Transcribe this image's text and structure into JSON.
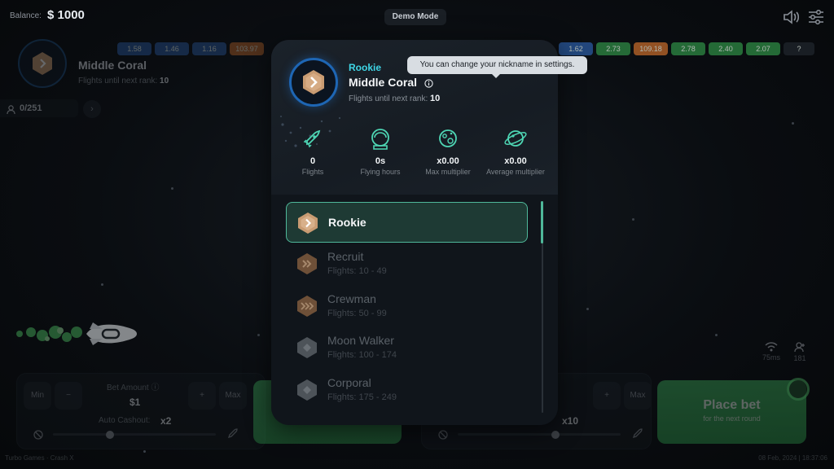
{
  "header": {
    "balance_label": "Balance:",
    "balance_value": "$ 1000",
    "mode": "Demo Mode"
  },
  "history": [
    {
      "value": "1.58",
      "color": "#2a5aa0"
    },
    {
      "value": "1.46",
      "color": "#2a5aa0"
    },
    {
      "value": "1.16",
      "color": "#2a5aa0"
    },
    {
      "value": "103.97",
      "color": "#c0682a"
    },
    {
      "value": "1.62",
      "color": "#2a5aa0"
    },
    {
      "value": "2.73",
      "color": "#2e8a44"
    },
    {
      "value": "109.18",
      "color": "#c0682a"
    },
    {
      "value": "2.78",
      "color": "#2e8a44"
    },
    {
      "value": "2.40",
      "color": "#2e8a44"
    },
    {
      "value": "2.07",
      "color": "#2e8a44"
    },
    {
      "value": "?",
      "color": "#1f252c"
    }
  ],
  "background_profile": {
    "name": "Middle Coral",
    "flights_label": "Flights until next rank:",
    "flights_value": "10",
    "players": "0/251"
  },
  "bet_panel_left": {
    "min": "Min",
    "minus": "−",
    "plus": "+",
    "max": "Max",
    "bet_amount_label": "Bet Amount",
    "bet_amount_value": "$1",
    "auto_cashout_label": "Auto Cashout:",
    "auto_cashout_value": "x2",
    "slider_fraction": 0.35
  },
  "bet_panel_right": {
    "plus": "+",
    "max": "Max",
    "auto_cashout_value": "x10",
    "place_bet_title": "Place bet",
    "place_bet_sub": "for the next round",
    "slider_fraction": 0.6
  },
  "network": {
    "ping": "75ms",
    "users": "181"
  },
  "footer": {
    "left": "Turbo Games · Crash X",
    "right": "08 Feb, 2024 | 18:37:06"
  },
  "modal": {
    "rank_label": "Rookie",
    "nickname": "Middle Coral",
    "tooltip": "You can change your nickname in settings.",
    "next_rank_label": "Flights until next rank:",
    "next_rank_value": "10",
    "stats": [
      {
        "value": "0",
        "label": "Flights",
        "icon": "rocket-icon"
      },
      {
        "value": "0s",
        "label": "Flying hours",
        "icon": "helmet-icon"
      },
      {
        "value": "x0.00",
        "label": "Max multiplier",
        "icon": "planet-icon"
      },
      {
        "value": "x0.00",
        "label": "Average multiplier",
        "icon": "planet-ring-icon"
      }
    ],
    "ranks": [
      {
        "name": "Rookie",
        "range": "",
        "active": true,
        "color": "#c89b72"
      },
      {
        "name": "Recruit",
        "range": "Flights: 10 - 49",
        "active": false,
        "color": "#7a5a40"
      },
      {
        "name": "Crewman",
        "range": "Flights: 50 - 99",
        "active": false,
        "color": "#7a5a40"
      },
      {
        "name": "Moon Walker",
        "range": "Flights: 100 - 174",
        "active": false,
        "color": "#5a6066"
      },
      {
        "name": "Corporal",
        "range": "Flights: 175 - 249",
        "active": false,
        "color": "#5a6066"
      }
    ]
  }
}
